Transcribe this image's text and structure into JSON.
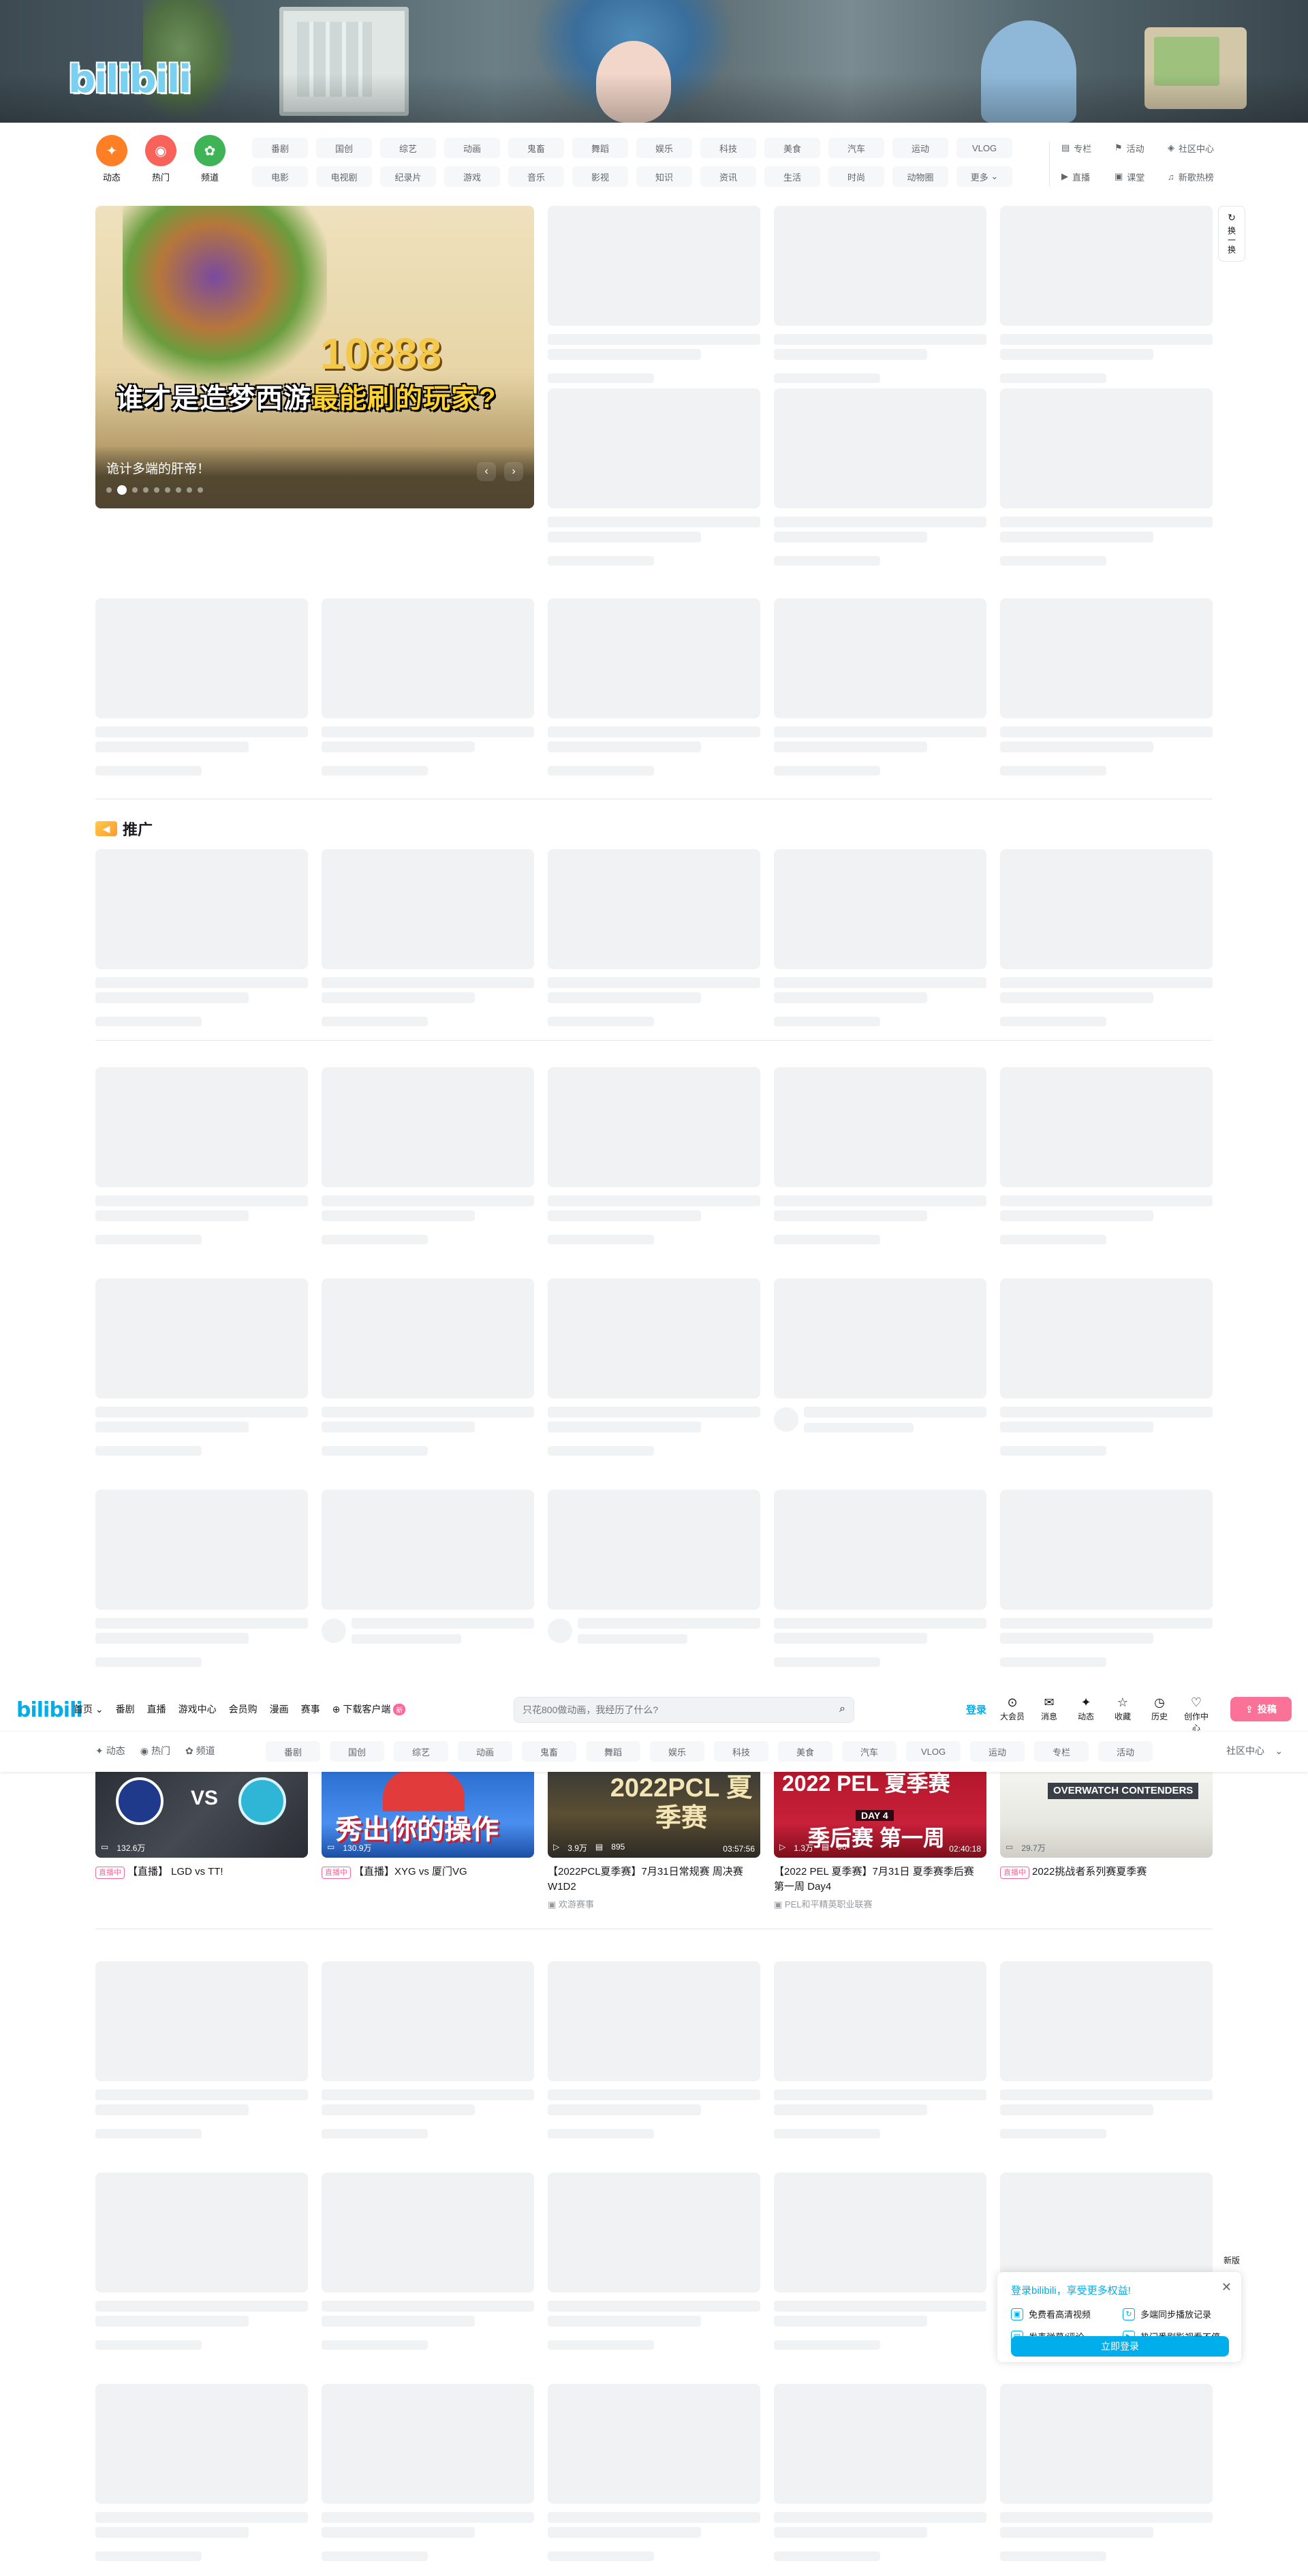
{
  "banner": {
    "logo": "bilibili"
  },
  "channels": {
    "main": [
      {
        "label": "动态",
        "color": "#ff7f24",
        "icon": "dynamic-icon"
      },
      {
        "label": "热门",
        "color": "#f9625b",
        "icon": "fire-icon"
      },
      {
        "label": "频道",
        "color": "#3eb457",
        "icon": "channel-icon"
      }
    ],
    "chips": [
      "番剧",
      "国创",
      "综艺",
      "动画",
      "鬼畜",
      "舞蹈",
      "娱乐",
      "科技",
      "美食",
      "汽车",
      "运动",
      "VLOG",
      "电影",
      "电视剧",
      "纪录片",
      "游戏",
      "音乐",
      "影视",
      "知识",
      "资讯",
      "生活",
      "时尚",
      "动物圈",
      "更多"
    ],
    "side": [
      {
        "label": "专栏",
        "icon": "column-icon"
      },
      {
        "label": "活动",
        "icon": "flag-icon"
      },
      {
        "label": "社区中心",
        "icon": "community-icon"
      },
      {
        "label": "直播",
        "icon": "live-icon"
      },
      {
        "label": "课堂",
        "icon": "class-icon"
      },
      {
        "label": "新歌热榜",
        "icon": "music-icon"
      }
    ]
  },
  "carousel": {
    "art_number": "10888",
    "headline_a": "谁才是造梦西游",
    "headline_b": "最能刷的玩家?",
    "caption": "诡计多端的肝帝！"
  },
  "refresh_label": "换一换",
  "section": {
    "title": "推广"
  },
  "sticky": {
    "logo": "bilibili",
    "nav": [
      "首页",
      "番剧",
      "直播",
      "游戏中心",
      "会员购",
      "漫画",
      "赛事"
    ],
    "download_label": "下载客户端",
    "download_badge": "新",
    "search_placeholder": "只花800做动画，我经历了什么?",
    "login": "登录",
    "right": [
      {
        "label": "大会员",
        "icon": "vip-icon"
      },
      {
        "label": "消息",
        "icon": "message-icon"
      },
      {
        "label": "动态",
        "icon": "dynamic-icon"
      },
      {
        "label": "收藏",
        "icon": "favorite-icon"
      },
      {
        "label": "历史",
        "icon": "history-icon"
      },
      {
        "label": "创作中心",
        "icon": "creator-icon"
      }
    ],
    "upload": "投稿",
    "sub_main": [
      "动态",
      "热门",
      "频道"
    ],
    "sub_chips": [
      "番剧",
      "国创",
      "综艺",
      "动画",
      "鬼畜",
      "舞蹈",
      "娱乐",
      "科技",
      "美食",
      "汽车",
      "VLOG",
      "运动",
      "专栏",
      "活动"
    ],
    "sub_more": "社区中心"
  },
  "live_cards": [
    {
      "tag": "直播中",
      "title": "【直播】 LGD vs TT!",
      "stats": [
        "132.6万"
      ],
      "duration": "",
      "owner": "",
      "art": "VS"
    },
    {
      "tag": "直播中",
      "title": "【直播】XYG vs 厦门VG",
      "stats": [
        "130.9万"
      ],
      "duration": "",
      "owner": "",
      "art": "秀出你的操作"
    },
    {
      "tag": "",
      "title": "【2022PCL夏季赛】7月31日常规赛 周决赛 W1D2",
      "stats": [
        "3.9万",
        "895"
      ],
      "duration": "03:57:56",
      "owner": "欢游赛事",
      "art": "2022PCL 夏季赛"
    },
    {
      "tag": "",
      "title": "【2022 PEL 夏季赛】7月31日 夏季赛季后赛 第一周 Day4",
      "stats": [
        "1.3万",
        "96"
      ],
      "duration": "02:40:18",
      "owner": "PEL和平精英职业联赛",
      "art": "2022 PEL 夏季赛",
      "art_day": "DAY 4",
      "art_b": "季后赛 第一周"
    },
    {
      "tag": "直播中",
      "title": "2022挑战者系列赛夏季赛",
      "stats": [
        "29.7万"
      ],
      "duration": "",
      "owner": "",
      "art": "OVERWATCH CONTENDERS"
    }
  ],
  "popup": {
    "title": "登录bilibili，享受更多权益!",
    "perks": [
      "免费看高清视频",
      "多端同步播放记录",
      "发表弹幕/评论",
      "热门番剧影视看不停"
    ],
    "button": "立即登录",
    "new_version": "新版"
  }
}
